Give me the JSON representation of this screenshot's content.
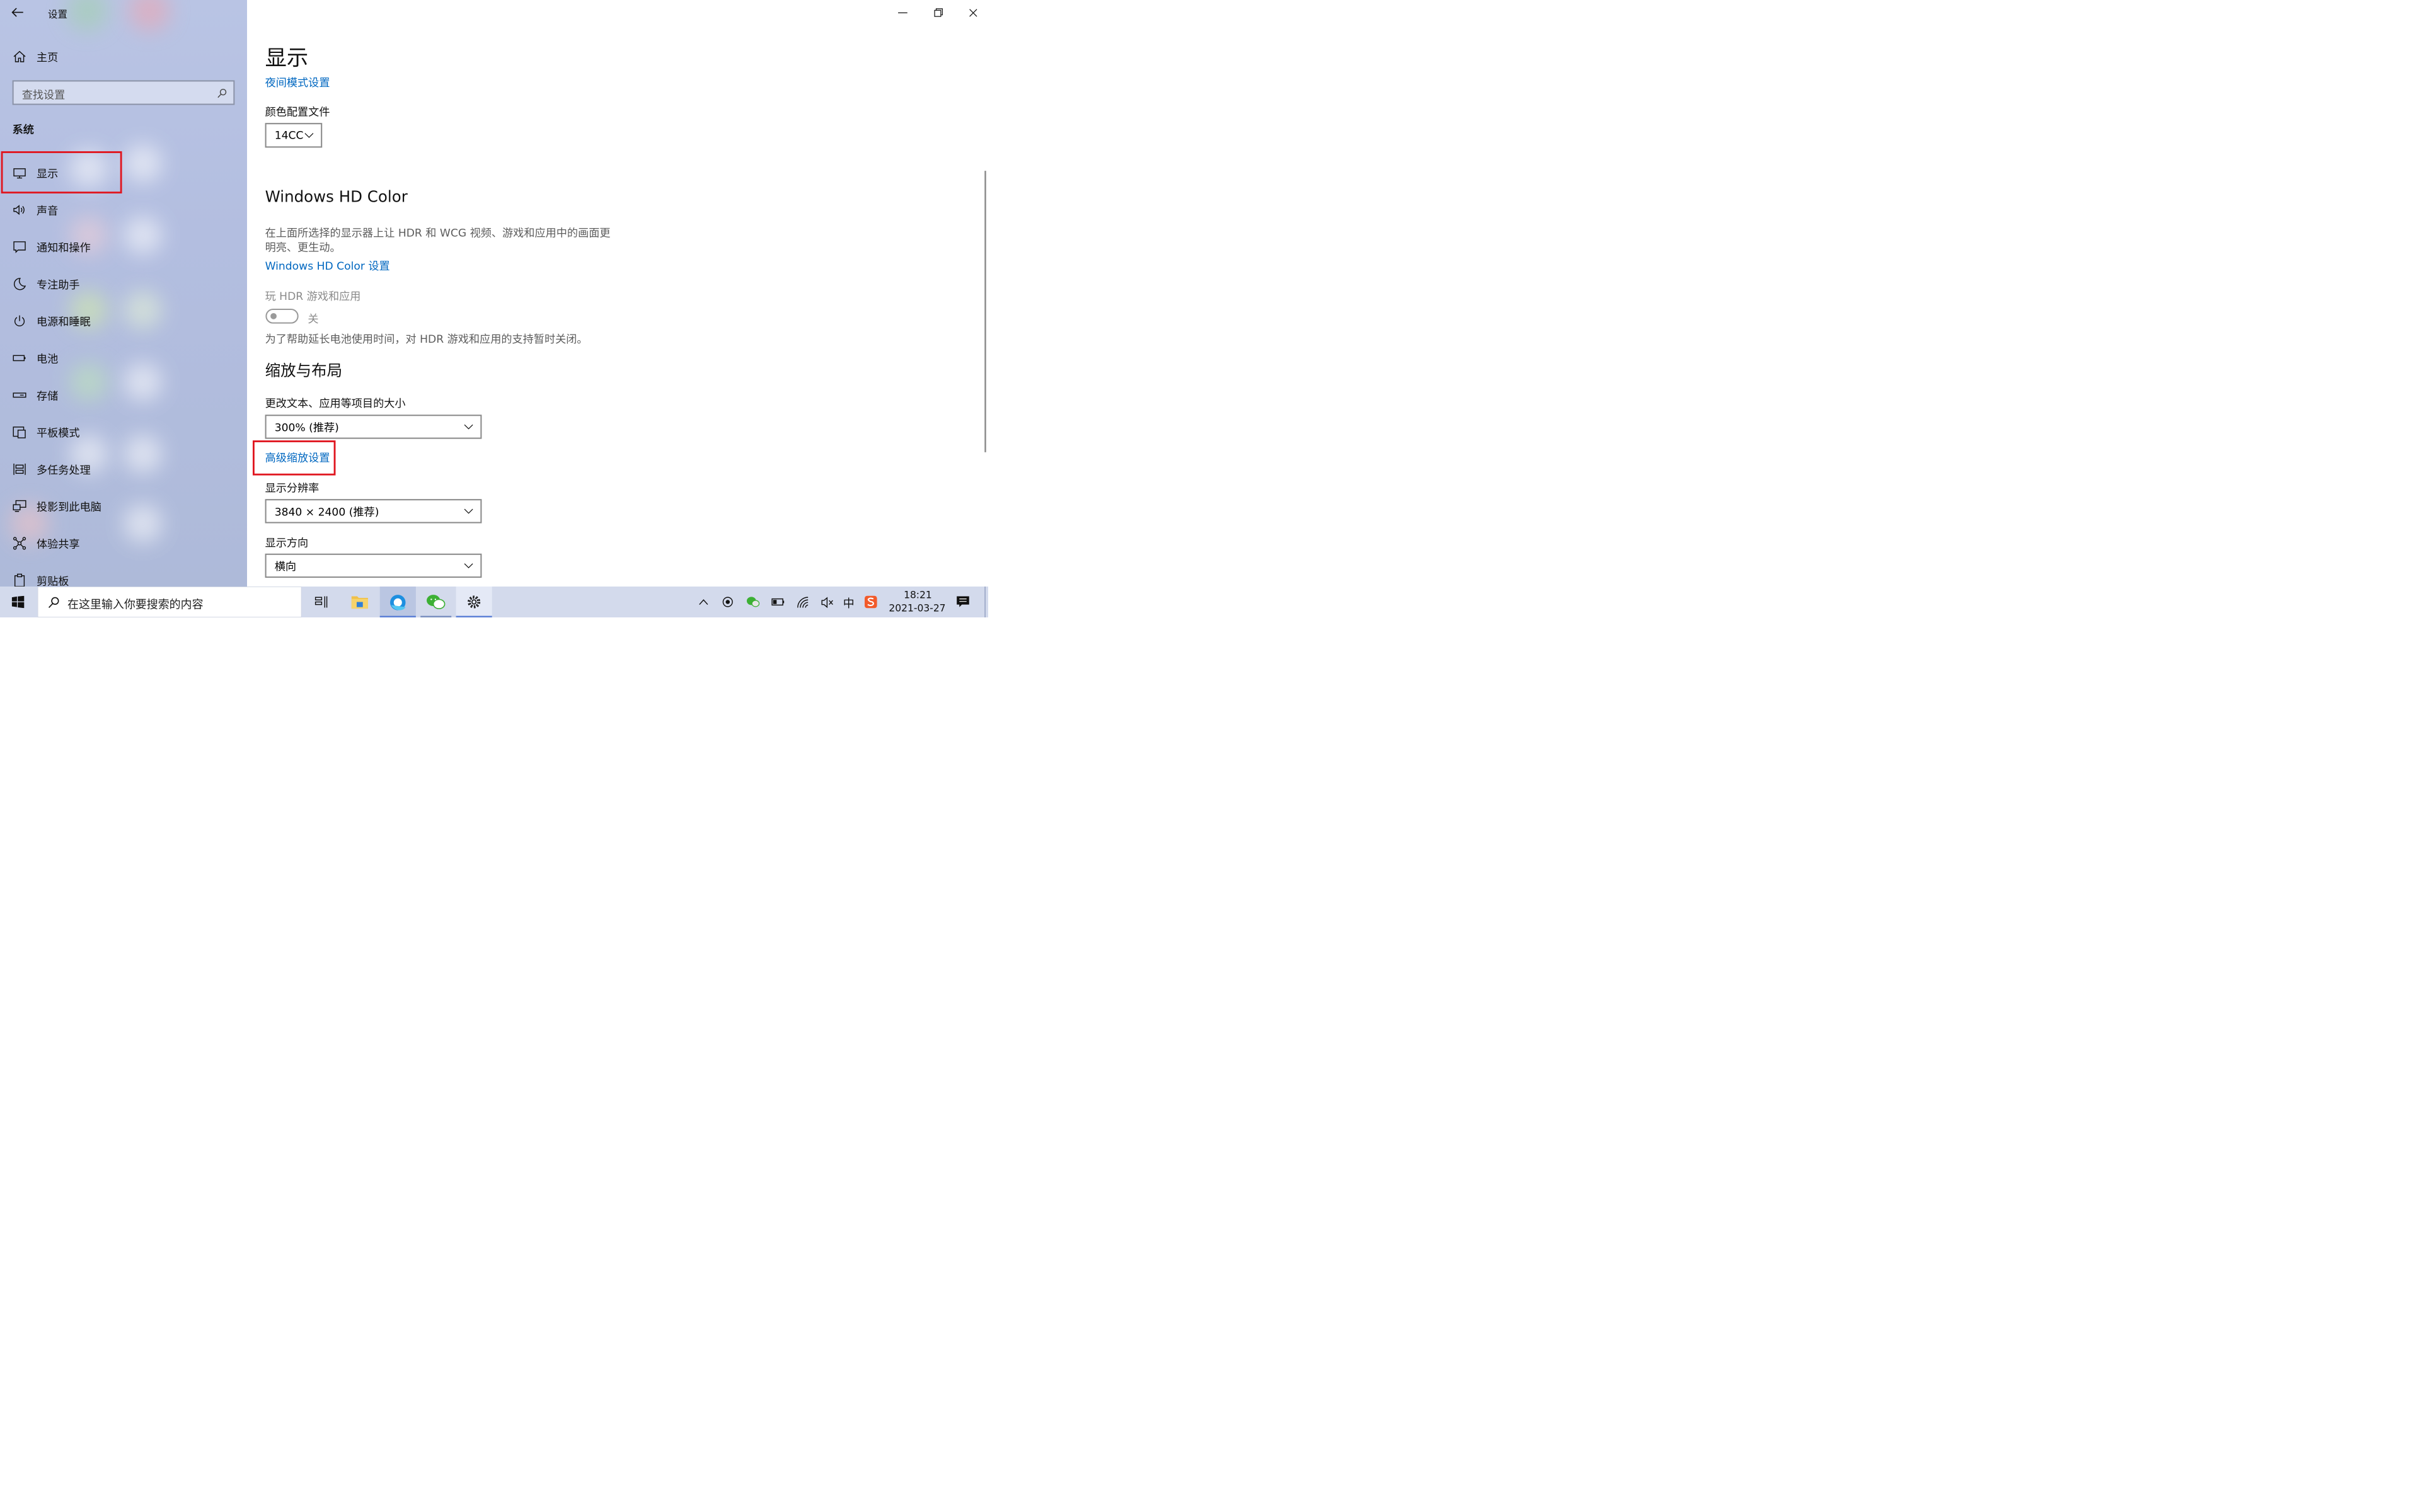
{
  "window": {
    "title": "设置",
    "controls": [
      "minimize-icon",
      "restore-icon",
      "close-icon"
    ]
  },
  "sidebar": {
    "home_label": "主页",
    "search_placeholder": "查找设置",
    "section_title": "系统",
    "items": [
      {
        "label": "显示",
        "icon": "monitor-icon",
        "selected": true
      },
      {
        "label": "声音",
        "icon": "speaker-icon"
      },
      {
        "label": "通知和操作",
        "icon": "notification-icon"
      },
      {
        "label": "专注助手",
        "icon": "moon-icon"
      },
      {
        "label": "电源和睡眠",
        "icon": "power-icon"
      },
      {
        "label": "电池",
        "icon": "battery-icon"
      },
      {
        "label": "存储",
        "icon": "storage-icon"
      },
      {
        "label": "平板模式",
        "icon": "tablet-mode-icon"
      },
      {
        "label": "多任务处理",
        "icon": "multitasking-icon"
      },
      {
        "label": "投影到此电脑",
        "icon": "project-icon"
      },
      {
        "label": "体验共享",
        "icon": "share-icon"
      },
      {
        "label": "剪贴板",
        "icon": "clipboard-icon"
      }
    ]
  },
  "main": {
    "page_title": "显示",
    "night_mode_link": "夜间模式设置",
    "color_profile": {
      "label": "颜色配置文件",
      "value": "14CC"
    },
    "hdr": {
      "title": "Windows HD Color",
      "description_line1": "在上面所选择的显示器上让 HDR 和 WCG 视频、游戏和应用中的画面更",
      "description_line2": "明亮、更生动。",
      "settings_link": "Windows HD Color 设置",
      "toggle_label": "玩 HDR 游戏和应用",
      "toggle_state": "关",
      "note": "为了帮助延长电池使用时间，对 HDR 游戏和应用的支持暂时关闭。"
    },
    "scale_layout": {
      "title": "缩放与布局",
      "size_label": "更改文本、应用等项目的大小",
      "size_value": "300% (推荐)",
      "advanced_link": "高级缩放设置",
      "resolution_label": "显示分辨率",
      "resolution_value": "3840 × 2400 (推荐)",
      "orientation_label": "显示方向",
      "orientation_value": "横向"
    }
  },
  "taskbar": {
    "search_placeholder": "在这里输入你要搜索的内容",
    "ime_label": "中",
    "time": "18:21",
    "date": "2021-03-27"
  },
  "colors": {
    "accent": "#0067c0",
    "highlight_box": "#e0161f",
    "sidebar_bg": "#b3bee0",
    "taskbar_bg": "#d3daec"
  }
}
